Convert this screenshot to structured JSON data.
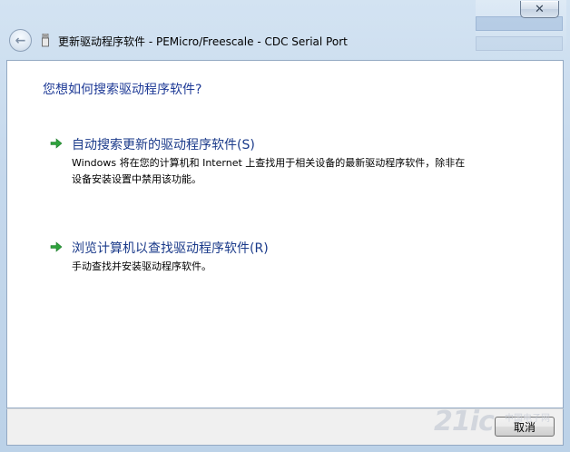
{
  "window": {
    "title": "更新驱动程序软件 - PEMicro/Freescale - CDC Serial Port",
    "close_glyph": "✕",
    "back_glyph": "←"
  },
  "content": {
    "heading": "您想如何搜索驱动程序软件?",
    "options": [
      {
        "label": "自动搜索更新的驱动程序软件(S)",
        "description": "Windows 将在您的计算机和 Internet 上查找用于相关设备的最新驱动程序软件，除非在设备安装设置中禁用该功能。"
      },
      {
        "label": "浏览计算机以查找驱动程序软件(R)",
        "description": "手动查找并安装驱动程序软件。"
      }
    ]
  },
  "footer": {
    "cancel_label": "取消"
  },
  "watermark": {
    "text": "21ic",
    "sub": "中国电子网"
  },
  "colors": {
    "heading": "#1e3a96",
    "option_label": "#1a3a8a",
    "arrow": "#2e9e3a",
    "glass": "#c5d8ec"
  },
  "icons": {
    "back": "back-arrow-icon",
    "device": "usb-device-icon",
    "option_arrow": "green-arrow-icon",
    "close": "close-icon"
  }
}
